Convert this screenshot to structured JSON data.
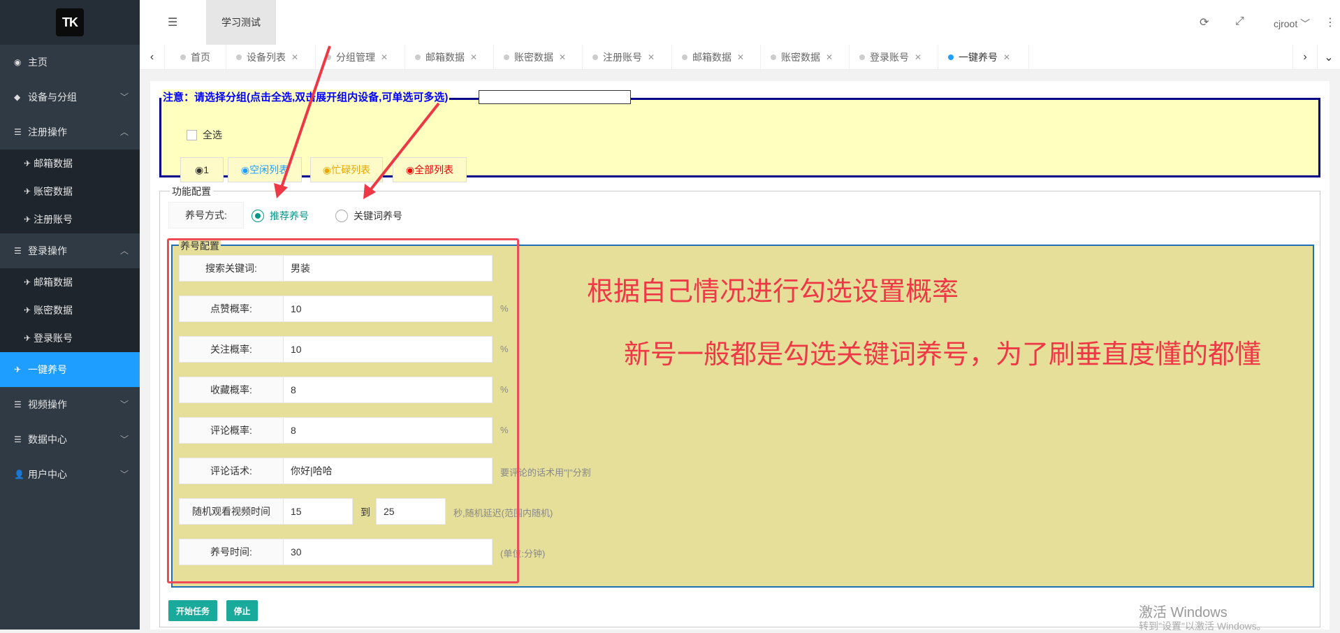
{
  "sidebar": {
    "logo": "TK",
    "items": [
      {
        "label": "主页",
        "icon": "dashboard-icon"
      },
      {
        "label": "设备与分组",
        "icon": "android-icon"
      },
      {
        "label": "注册操作",
        "icon": "server-icon"
      },
      {
        "label": "登录操作",
        "icon": "server-icon"
      },
      {
        "label": "一键养号",
        "icon": "plane-icon"
      },
      {
        "label": "视频操作",
        "icon": "server-icon"
      },
      {
        "label": "数据中心",
        "icon": "server-icon"
      },
      {
        "label": "用户中心",
        "icon": "user-add-icon"
      }
    ],
    "register_sub": [
      "邮箱数据",
      "账密数据",
      "注册账号"
    ],
    "login_sub": [
      "邮箱数据",
      "账密数据",
      "登录账号"
    ]
  },
  "header": {
    "title": "学习测试",
    "user": "cjroot"
  },
  "tabs": [
    "首页",
    "设备列表",
    "分组管理",
    "邮箱数据",
    "账密数据",
    "注册账号",
    "邮箱数据",
    "账密数据",
    "登录账号",
    "一键养号"
  ],
  "notice": {
    "legend": "注意：请选择分组(点击全选,双击展开组内设备,可单选可多选)",
    "select_all": "全选",
    "groups": [
      "◉1",
      "◉空闲列表",
      "◉忙碌列表",
      "◉全部列表"
    ]
  },
  "func": {
    "legend": "功能配置",
    "mode_label": "养号方式:",
    "mode_options": [
      "推荐养号",
      "关键词养号"
    ]
  },
  "yh": {
    "legend": "养号配置",
    "rows": [
      {
        "label": "搜索关键词:",
        "value": "男装",
        "unit": ""
      },
      {
        "label": "点赞概率:",
        "value": "10",
        "unit": "%"
      },
      {
        "label": "关注概率:",
        "value": "10",
        "unit": "%"
      },
      {
        "label": "收藏概率:",
        "value": "8",
        "unit": "%"
      },
      {
        "label": "评论概率:",
        "value": "8",
        "unit": "%"
      },
      {
        "label": "评论话术:",
        "value": "你好|哈哈",
        "unit": "要评论的话术用\"|\"分割"
      },
      {
        "label": "随机观看视频时间",
        "value": "15",
        "unit": "秒,随机延迟(范围内随机)"
      },
      {
        "label": "养号时间:",
        "value": "30",
        "unit": "(单位:分钟)"
      }
    ],
    "to_label": "到",
    "watch_max": "25"
  },
  "annotations": {
    "line1": "根据自己情况进行勾选设置概率",
    "line2": "新号一般都是勾选关键词养号，为了刷垂直度懂的都懂"
  },
  "actions": {
    "start": "开始任务",
    "stop": "停止"
  },
  "watermark": {
    "title": "激活 Windows",
    "subtitle": "转到\"设置\"以激活 Windows。"
  }
}
